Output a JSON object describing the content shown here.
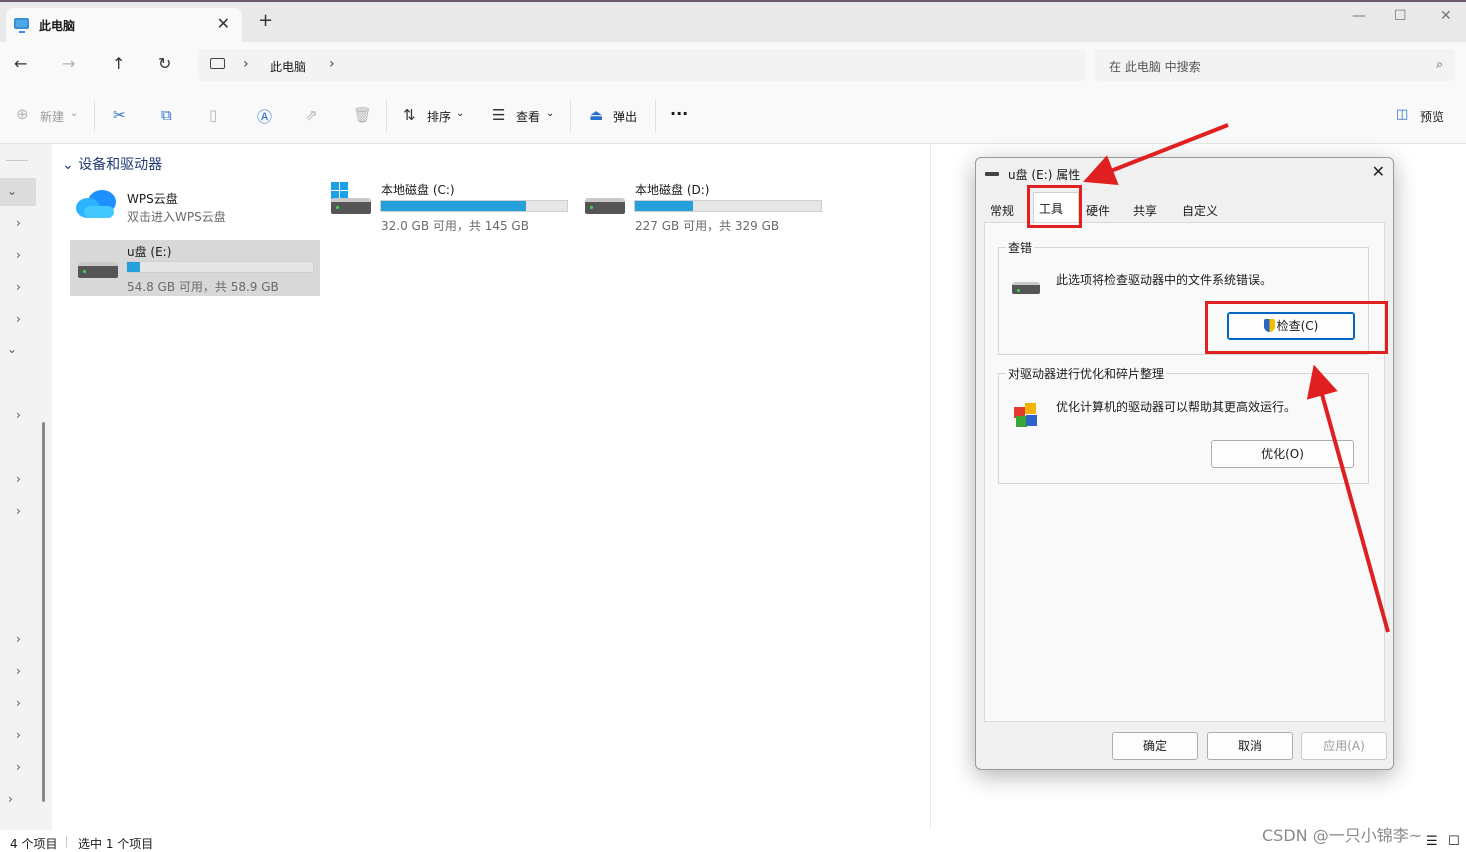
{
  "window": {
    "tab_title": "此电脑",
    "tab_close": "✕",
    "new_tab": "+",
    "minimize": "—",
    "maximize": "☐",
    "close": "✕"
  },
  "nav": {
    "back": "←",
    "forward": "→",
    "up": "↑",
    "refresh": "↻",
    "breadcrumb": "此电脑",
    "search_placeholder": "在 此电脑 中搜索"
  },
  "toolbar": {
    "new_label": "新建",
    "sort_label": "排序",
    "view_label": "查看",
    "eject_label": "弹出",
    "more_label": "···",
    "preview_label": "预览"
  },
  "section": {
    "title": "设备和驱动器"
  },
  "drives": [
    {
      "name": "WPS云盘",
      "subtitle": "双击进入WPS云盘"
    },
    {
      "name": "本地磁盘 (C:)",
      "subtitle": "32.0 GB 可用，共 145 GB",
      "used_fraction": 0.78
    },
    {
      "name": "本地磁盘 (D:)",
      "subtitle": "227 GB 可用，共 329 GB",
      "used_fraction": 0.31
    },
    {
      "name": "u盘 (E:)",
      "subtitle": "54.8 GB 可用，共 58.9 GB",
      "used_fraction": 0.07
    }
  ],
  "status": {
    "items_count": "4 个项目",
    "selected": "选中 1 个项目"
  },
  "watermark": "CSDN @一只小锦李~",
  "dialog": {
    "title": "u盘 (E:) 属性",
    "close": "✕",
    "tabs": [
      "常规",
      "工具",
      "硬件",
      "共享",
      "自定义"
    ],
    "active_tab": "工具",
    "error_check": {
      "legend": "查错",
      "description": "此选项将检查驱动器中的文件系统错误。",
      "button": "检查(C)"
    },
    "optimize": {
      "legend": "对驱动器进行优化和碎片整理",
      "description": "优化计算机的驱动器可以帮助其更高效运行。",
      "button": "优化(O)"
    },
    "ok": "确定",
    "cancel": "取消",
    "apply": "应用(A)"
  },
  "colors": {
    "accent": "#26a0da",
    "annotation_red": "#e02020"
  }
}
